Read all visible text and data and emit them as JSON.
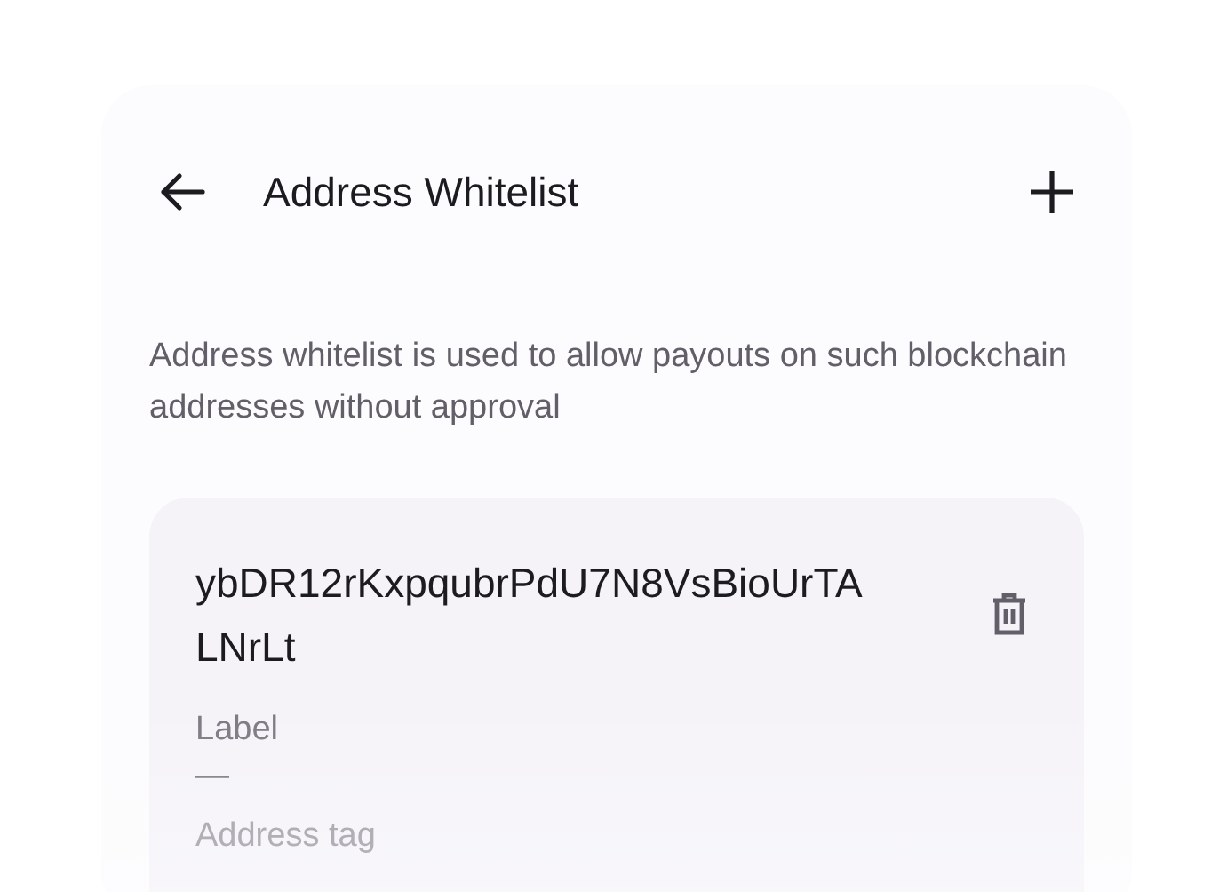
{
  "header": {
    "title": "Address Whitelist"
  },
  "description": "Address whitelist is used to allow payouts on such blockchain addresses without approval",
  "addresses": [
    {
      "address": "ybDR12rKxpqubrPdU7N8VsBioUrTALNrLt",
      "fields": [
        {
          "label": "Label",
          "value": "—"
        },
        {
          "label": "Address tag"
        }
      ]
    }
  ]
}
